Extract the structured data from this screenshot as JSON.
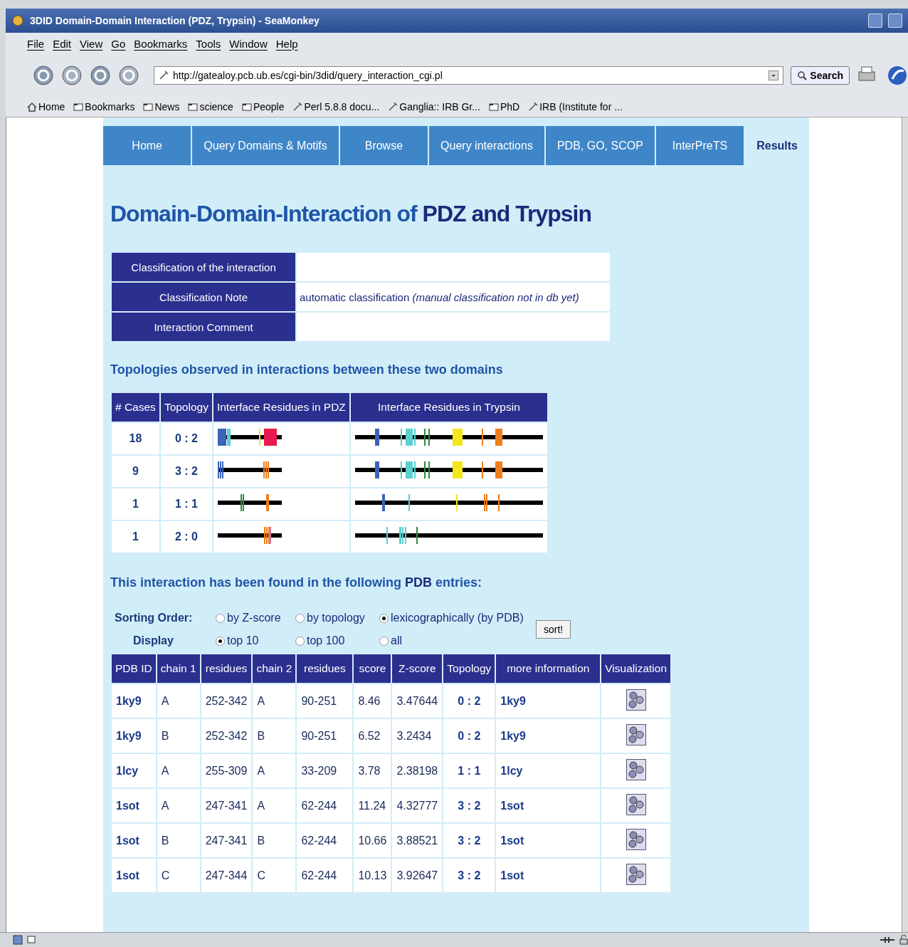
{
  "window": {
    "title": "3DID Domain-Domain Interaction (PDZ, Trypsin) - SeaMonkey"
  },
  "menu": [
    "File",
    "Edit",
    "View",
    "Go",
    "Bookmarks",
    "Tools",
    "Window",
    "Help"
  ],
  "address": {
    "value": "http://gatealoy.pcb.ub.es/cgi-bin/3did/query_interaction_cgi.pl"
  },
  "search_button": "Search",
  "bookmarks": [
    {
      "kind": "home",
      "label": "Home"
    },
    {
      "kind": "folder",
      "label": "Bookmarks"
    },
    {
      "kind": "folder",
      "label": "News"
    },
    {
      "kind": "folder",
      "label": "science"
    },
    {
      "kind": "folder",
      "label": "People"
    },
    {
      "kind": "link",
      "label": "Perl 5.8.8 docu..."
    },
    {
      "kind": "link",
      "label": "Ganglia:: IRB Gr..."
    },
    {
      "kind": "folder",
      "label": "PhD"
    },
    {
      "kind": "link",
      "label": "IRB (Institute for ..."
    }
  ],
  "nav": [
    {
      "label": "Home",
      "selected": false
    },
    {
      "label": "Query Domains & Motifs",
      "selected": false
    },
    {
      "label": "Browse",
      "selected": false
    },
    {
      "label": "Query interactions",
      "selected": false
    },
    {
      "label": "PDB, GO, SCOP",
      "selected": false
    },
    {
      "label": "InterPreTS",
      "selected": false
    },
    {
      "label": "Results",
      "selected": true
    }
  ],
  "heading": "Domain-Domain-Interaction of **PDZ and Trypsin**",
  "info": [
    {
      "label": "Classification of the interaction"
    },
    {
      "label": "Classification Note",
      "value": "automatic classification *(manual classification not in db yet)*"
    },
    {
      "label": "Interaction Comment"
    }
  ],
  "topologies_heading": "Topologies observed in interactions between these two domains",
  "topologies": {
    "columns": [
      "# Cases",
      "Topology",
      "Interface Residues in PDZ",
      "Interface Residues in Trypsin"
    ],
    "rows": [
      {
        "cases": "18",
        "topology": "0 : 2"
      },
      {
        "cases": "9",
        "topology": "3 : 2"
      },
      {
        "cases": "1",
        "topology": "1 : 1"
      },
      {
        "cases": "1",
        "topology": "2 : 0"
      }
    ]
  },
  "entries_heading": "This interaction has been found in the following **PDB** entries:",
  "sorting": {
    "label": "Sorting Order:",
    "options": [
      {
        "label": "by Z-score",
        "selected": false
      },
      {
        "label": "by topology",
        "selected": false
      },
      {
        "label": "lexicographically (by PDB)",
        "selected": true
      }
    ]
  },
  "display": {
    "label": "Display",
    "options": [
      {
        "label": "top 10",
        "selected": true
      },
      {
        "label": "top 100",
        "selected": false
      },
      {
        "label": "all",
        "selected": false
      }
    ]
  },
  "sort_button": "sort!",
  "results": {
    "columns": [
      "PDB ID",
      "chain 1",
      "residues",
      "chain 2",
      "residues",
      "score",
      "Z-score",
      "Topology",
      "more information",
      "Visualization"
    ],
    "rows": [
      [
        "1ky9",
        "A",
        "252-342",
        "A",
        "90-251",
        "8.46",
        "3.47644",
        "0 : 2",
        "1ky9"
      ],
      [
        "1ky9",
        "B",
        "252-342",
        "B",
        "90-251",
        "6.52",
        "3.2434",
        "0 : 2",
        "1ky9"
      ],
      [
        "1lcy",
        "A",
        "255-309",
        "A",
        "33-209",
        "3.78",
        "2.38198",
        "1 : 1",
        "1lcy"
      ],
      [
        "1sot",
        "A",
        "247-341",
        "A",
        "62-244",
        "11.24",
        "4.32777",
        "3 : 2",
        "1sot"
      ],
      [
        "1sot",
        "B",
        "247-341",
        "B",
        "62-244",
        "10.66",
        "3.88521",
        "3 : 2",
        "1sot"
      ],
      [
        "1sot",
        "C",
        "247-344",
        "C",
        "62-244",
        "10.13",
        "3.92647",
        "3 : 2",
        "1sot"
      ]
    ]
  }
}
